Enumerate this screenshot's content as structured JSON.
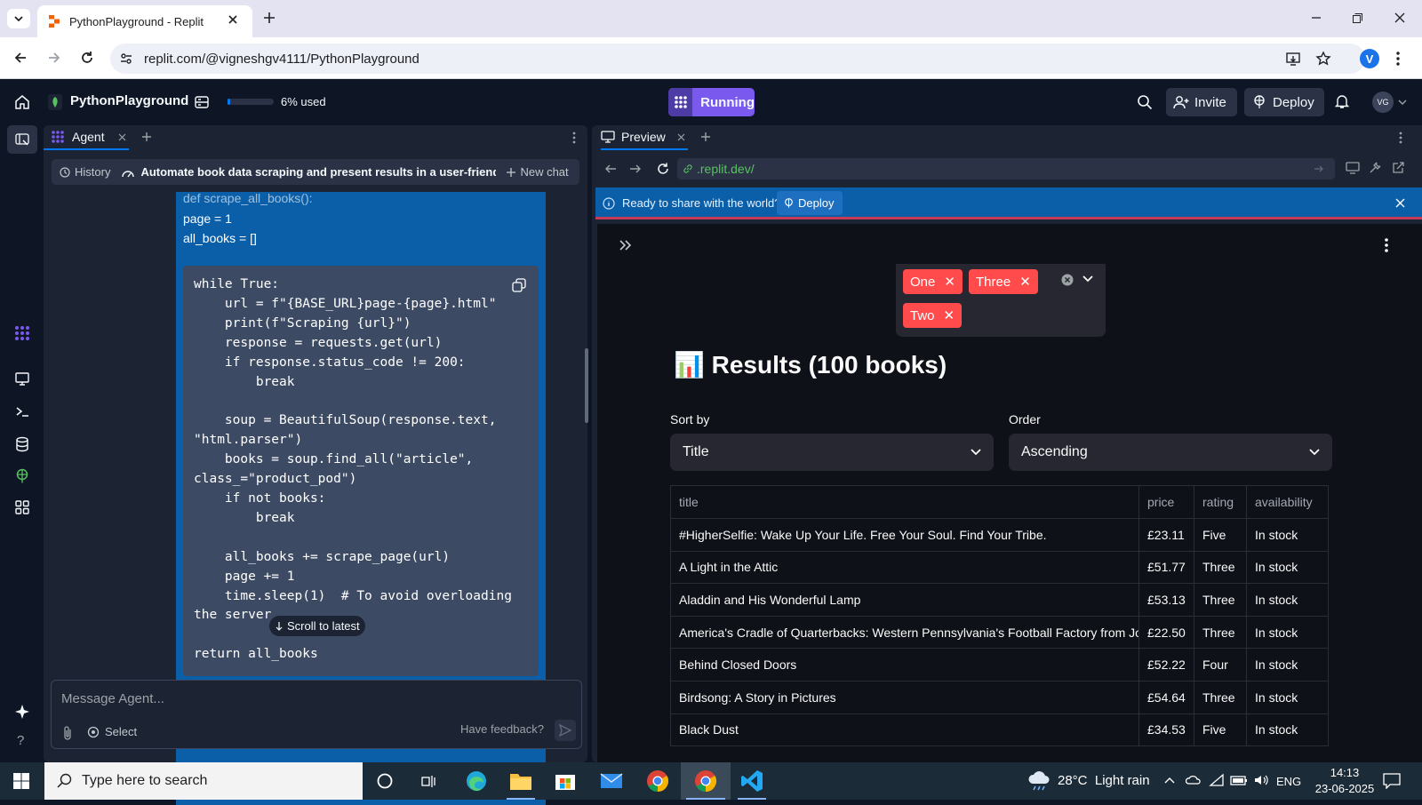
{
  "browser": {
    "tab_title": "PythonPlayground - Replit",
    "url": "replit.com/@vigneshgv4111/PythonPlayground",
    "profile_initial": "V"
  },
  "header": {
    "project_name": "PythonPlayground",
    "usage_text": "6% used",
    "usage_percent": 6,
    "run_label": "Running",
    "invite_label": "Invite",
    "deploy_label": "Deploy",
    "avatar_initials": "VG"
  },
  "agent": {
    "tab_label": "Agent",
    "history_label": "History",
    "chat_title": "Automate book data scraping and present results in a user-friendly w...",
    "new_chat_label": "New chat",
    "pre_code": [
      "def scrape_all_books():",
      "page = 1",
      "all_books = []"
    ],
    "code": "while True:\n    url = f\"{BASE_URL}page-{page}.html\"\n    print(f\"Scraping {url}\")\n    response = requests.get(url)\n    if response.status_code != 200:\n        break\n\n    soup = BeautifulSoup(response.text,\n\"html.parser\")\n    books = soup.find_all(\"article\",\nclass_=\"product_pod\")\n    if not books:\n        break\n\n    all_books += scrape_page(url)\n    page += 1\n    time.sleep(1)  # To avoid overloading\nthe server\n\nreturn all_books",
    "scroll_to_latest": "Scroll to latest",
    "input_placeholder": "Message Agent...",
    "select_label": "Select",
    "feedback_label": "Have feedback?"
  },
  "preview": {
    "tab_label": "Preview",
    "url": ".replit.dev/",
    "banner_text": "Ready to share with the world?",
    "banner_button": "Deploy"
  },
  "app": {
    "filter_tags": [
      "One",
      "Three",
      "Two"
    ],
    "results_title": "📊 Results (100 books)",
    "sort_by_label": "Sort by",
    "sort_by_value": "Title",
    "order_label": "Order",
    "order_value": "Ascending",
    "table": {
      "columns": [
        "title",
        "price",
        "rating",
        "availability"
      ],
      "rows": [
        [
          "#HigherSelfie: Wake Up Your Life. Free Your Soul. Find Your Tribe.",
          "£23.11",
          "Five",
          "In stock"
        ],
        [
          "A Light in the Attic",
          "£51.77",
          "Three",
          "In stock"
        ],
        [
          "Aladdin and His Wonderful Lamp",
          "£53.13",
          "Three",
          "In stock"
        ],
        [
          "America's Cradle of Quarterbacks: Western Pennsylvania's Football Factory from John",
          "£22.50",
          "Three",
          "In stock"
        ],
        [
          "Behind Closed Doors",
          "£52.22",
          "Four",
          "In stock"
        ],
        [
          "Birdsong: A Story in Pictures",
          "£54.64",
          "Three",
          "In stock"
        ],
        [
          "Black Dust",
          "£34.53",
          "Five",
          "In stock"
        ]
      ]
    }
  },
  "taskbar": {
    "search_placeholder": "Type here to search",
    "weather": "28°C  Light rain",
    "language": "ENG",
    "time": "14:13",
    "date": "23-06-2025"
  },
  "colors": {
    "replit_bg": "#0e1525",
    "panel_bg": "#1c2333",
    "running_purple": "#7a59ef",
    "streamlit_red": "#ff4b4b",
    "banner_blue": "#0b5fa9"
  }
}
